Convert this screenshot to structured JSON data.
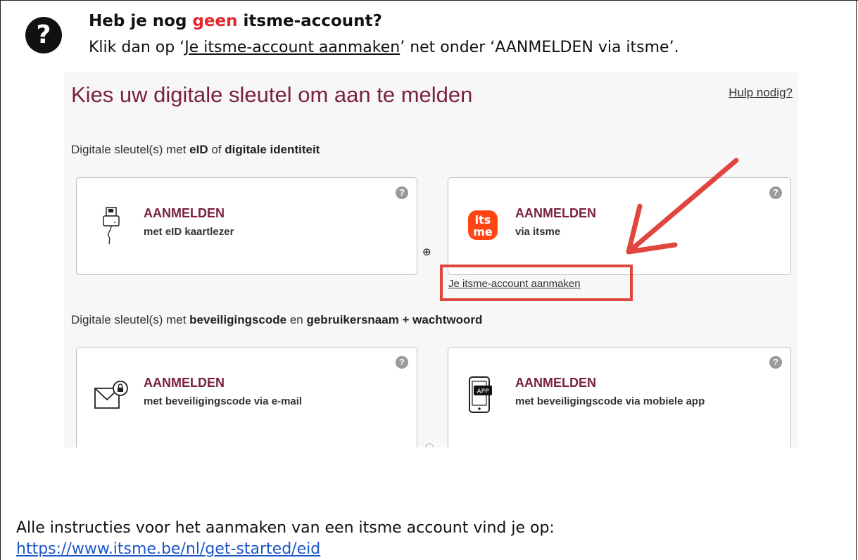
{
  "header": {
    "question_mark": "?",
    "headline_before": "Heb je nog ",
    "headline_highlight": "geen",
    "headline_after": " itsme-account?",
    "subline_before": "Klik dan op ‘",
    "subline_link": "Je itsme-account aanmaken",
    "subline_after": "’ net onder ‘AANMELDEN via itsme’."
  },
  "screenshot": {
    "title": "Kies uw digitale sleutel om aan te melden",
    "help_link": "Hulp nodig?",
    "section1": {
      "prefix": "Digitale sleutel(s) met ",
      "bold1": "eID",
      "mid": " of ",
      "bold2": "digitale identiteit"
    },
    "section2": {
      "prefix": "Digitale sleutel(s) met ",
      "bold1": "beveiligingscode",
      "mid": " en ",
      "bold2": "gebruikersnaam + wachtwoord"
    },
    "cards": [
      {
        "title": "AANMELDEN",
        "sub": "met eID kaartlezer",
        "icon": "card-reader-icon"
      },
      {
        "title": "AANMELDEN",
        "sub": "via itsme",
        "icon": "itsme-logo-icon",
        "logo_text_top": "its",
        "logo_text_bottom": "me"
      },
      {
        "title": "AANMELDEN",
        "sub": "met beveiligingscode via e-mail",
        "icon": "email-lock-icon"
      },
      {
        "title": "AANMELDEN",
        "sub": "met beveiligingscode via mobiele app",
        "icon": "mobile-app-icon",
        "app_label": "APP"
      }
    ],
    "help_icon_glyph": "?",
    "plus_glyph": "⊕",
    "create_account_link": "Je itsme-account aanmaken"
  },
  "footer": {
    "text": "Alle instructies voor het aanmaken van een itsme account vind je op:",
    "url": "https://www.itsme.be/nl/get-started/eid"
  },
  "colors": {
    "highlight_red": "#e3262d",
    "title_maroon": "#7a2041",
    "arrow_red": "#e0453e",
    "itsme_orange": "#ff4612",
    "link_blue": "#1a56c8"
  }
}
